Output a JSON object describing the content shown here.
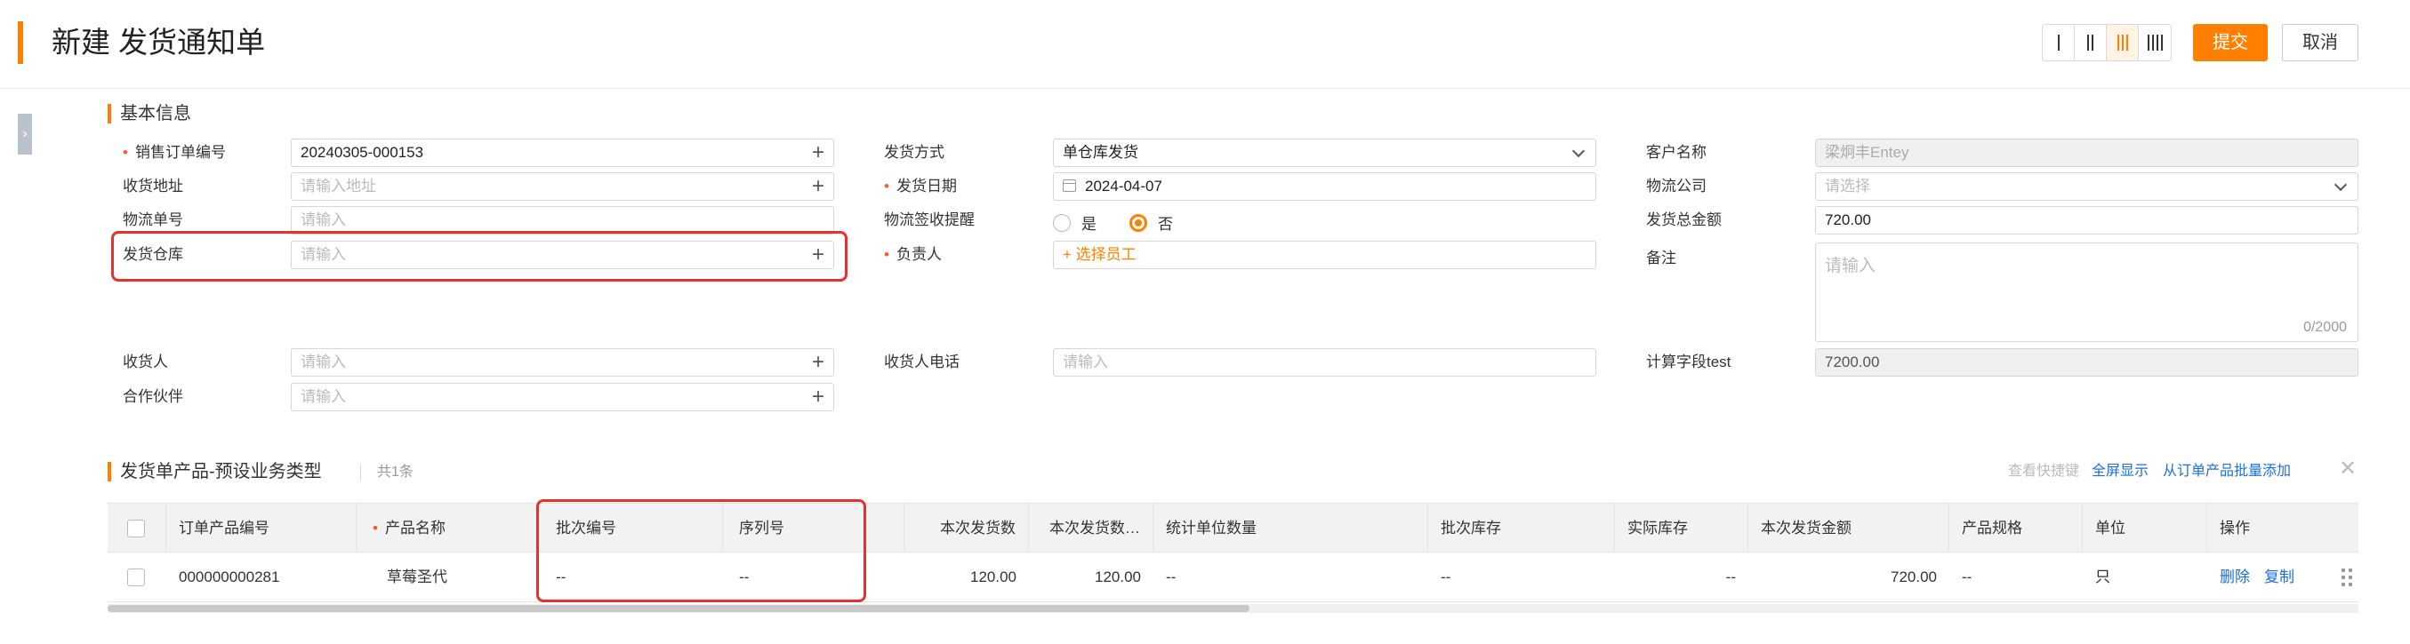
{
  "header": {
    "title": "新建 发货通知单",
    "submit_label": "提交",
    "cancel_label": "取消"
  },
  "section_basic": {
    "title": "基本信息"
  },
  "form": {
    "sales_order_no": {
      "label": "销售订单编号",
      "value": "20240305-000153"
    },
    "ship_address": {
      "label": "收货地址",
      "placeholder": "请输入地址"
    },
    "logistics_no": {
      "label": "物流单号",
      "placeholder": "请输入"
    },
    "ship_warehouse": {
      "label": "发货仓库",
      "placeholder": "请输入"
    },
    "receiver": {
      "label": "收货人",
      "placeholder": "请输入"
    },
    "partner": {
      "label": "合作伙伴",
      "placeholder": "请输入"
    },
    "ship_method": {
      "label": "发货方式",
      "value": "单仓库发货"
    },
    "ship_date": {
      "label": "发货日期",
      "value": "2024-04-07"
    },
    "sign_reminder": {
      "label": "物流签收提醒",
      "opt_yes": "是",
      "opt_no": "否"
    },
    "owner": {
      "label": "负责人",
      "action": "+ 选择员工"
    },
    "receiver_phone": {
      "label": "收货人电话",
      "placeholder": "请输入"
    },
    "customer_name": {
      "label": "客户名称",
      "value": "梁炯丰Entey"
    },
    "logistics_company": {
      "label": "物流公司",
      "placeholder": "请选择"
    },
    "ship_total_amount": {
      "label": "发货总金额",
      "value": "720.00"
    },
    "remark": {
      "label": "备注",
      "placeholder": "请输入",
      "counter": "0/2000"
    },
    "calc_field": {
      "label": "计算字段test",
      "value": "7200.00"
    }
  },
  "products": {
    "title": "发货单产品-预设业务类型",
    "count": "共1条",
    "shortcut_label": "查看快捷键",
    "fullscreen_label": "全屏显示",
    "batch_add_label": "从订单产品批量添加",
    "columns": [
      "订单产品编号",
      "产品名称",
      "批次编号",
      "序列号",
      "本次发货数",
      "本次发货数…",
      "统计单位数量",
      "批次库存",
      "实际库存",
      "本次发货金额",
      "产品规格",
      "单位",
      "操作"
    ],
    "rows": [
      {
        "order_product_no": "000000000281",
        "product_name": "草莓圣代",
        "batch_no": "--",
        "serial_no": "--",
        "ship_qty": "120.00",
        "ship_qty2": "120.00",
        "stat_unit_qty": "--",
        "batch_stock": "--",
        "actual_stock": "--",
        "ship_amount": "720.00",
        "spec": "--",
        "unit": "只",
        "delete_label": "删除",
        "copy_label": "复制"
      }
    ]
  },
  "colors": {
    "accent": "#ff8000",
    "highlight": "#e8312a",
    "link": "#1a6fd9"
  }
}
